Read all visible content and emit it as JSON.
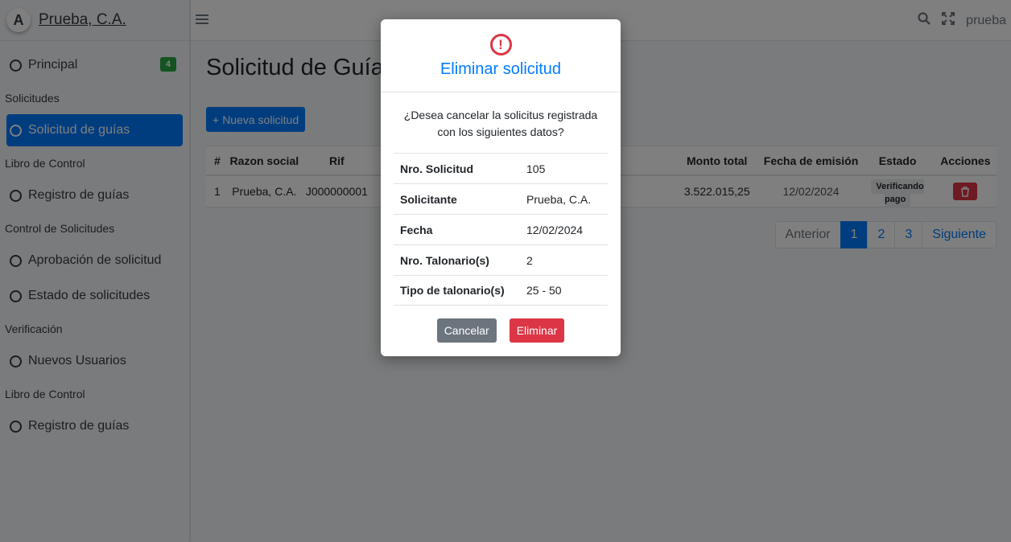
{
  "brand": {
    "logo": "A",
    "name": "Prueba, C.A."
  },
  "sidebar": {
    "items": [
      {
        "type": "item",
        "label": "Principal",
        "badge": "4"
      },
      {
        "type": "header",
        "label": "Solicitudes"
      },
      {
        "type": "item",
        "label": "Solicitud de guías",
        "active": true
      },
      {
        "type": "header",
        "label": "Libro de Control"
      },
      {
        "type": "item",
        "label": "Registro de guías"
      },
      {
        "type": "header",
        "label": "Control de Solicitudes"
      },
      {
        "type": "item",
        "label": "Aprobación de solicitud"
      },
      {
        "type": "item",
        "label": "Estado de solicitudes"
      },
      {
        "type": "header",
        "label": "Verificación"
      },
      {
        "type": "item",
        "label": "Nuevos Usuarios"
      },
      {
        "type": "header",
        "label": "Libro de Control"
      },
      {
        "type": "item",
        "label": "Registro de guías"
      }
    ]
  },
  "topbar": {
    "menu_icon": "hamburger-icon",
    "search_icon": "search-icon",
    "expand_icon": "expand-icon",
    "user": "prueba"
  },
  "page": {
    "title": "Solicitud de Guías",
    "new_button": "Nueva solicitud"
  },
  "table": {
    "headers": [
      "#",
      "Razon social",
      "Rif",
      "Monto total",
      "Fecha de emisión",
      "Estado",
      "Acciones"
    ],
    "rows": [
      {
        "num": "1",
        "razon": "Prueba, C.A.",
        "rif": "J000000001",
        "monto": "3.522.015,25",
        "fecha": "12/02/2024",
        "estado": "Verificando pago"
      }
    ]
  },
  "pagination": {
    "prev": "Anterior",
    "pages": [
      "1",
      "2",
      "3"
    ],
    "next": "Siguiente"
  },
  "modal": {
    "icon": "exclamation-circle-icon",
    "title": "Eliminar solicitud",
    "message": "¿Desea cancelar la solicitus registrada con los siguientes datos?",
    "details": [
      {
        "label": "Nro. Solicitud",
        "value": "105"
      },
      {
        "label": "Solicitante",
        "value": "Prueba, C.A."
      },
      {
        "label": "Fecha",
        "value": "12/02/2024"
      },
      {
        "label": "Nro. Talonario(s)",
        "value": "2"
      },
      {
        "label": "Tipo de talonario(s)",
        "value": "25 - 50"
      }
    ],
    "cancel": "Cancelar",
    "delete": "Eliminar"
  },
  "colors": {
    "primary": "#007bff",
    "danger": "#dc3545",
    "secondary": "#6c757d",
    "success": "#28a745"
  }
}
